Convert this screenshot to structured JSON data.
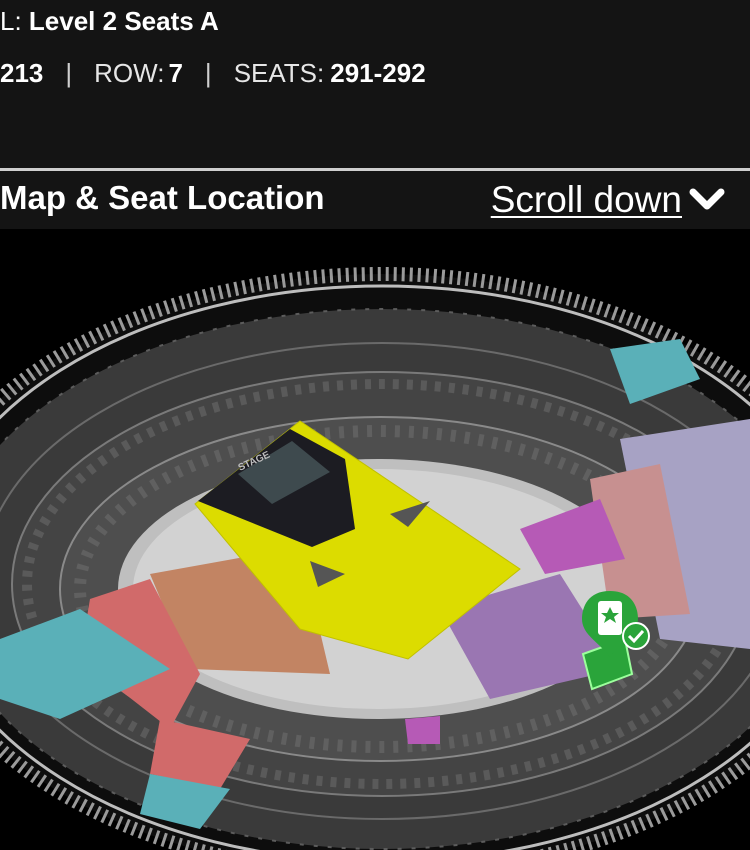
{
  "ticket": {
    "level_prefix": "L:",
    "level_value": "Level 2 Seats A",
    "section_value": "213",
    "row_label": "ROW:",
    "row_value": "7",
    "seats_label": "SEATS:",
    "seats_value": "291-292",
    "separator": "|"
  },
  "map_header": {
    "title": "Map & Seat Location",
    "scroll_label": "Scroll down"
  },
  "stadium_map": {
    "stage_label": "STAGE",
    "colors": {
      "pitch": "#dcdc00",
      "stage": "#1c1c22",
      "orange_sections": "#c28463",
      "teal_sections": "#5ab0b8",
      "red_sections": "#d16a6a",
      "purple_sections": "#9a76b2",
      "magenta_sections": "#b65ab6",
      "lavender_sections": "#a7a2c4",
      "pink_sections": "#c79090",
      "selected_marker": "#2aa43a"
    }
  }
}
